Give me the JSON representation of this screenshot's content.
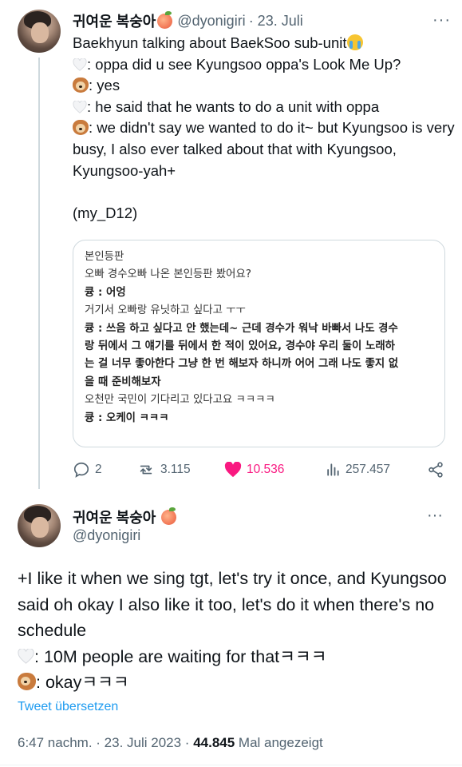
{
  "tweet1": {
    "display_name": "귀여운 복숭아",
    "handle": "@dyonigiri",
    "date": "· 23. Juli",
    "more": "···",
    "lines": [
      "Baekhyun talking about BaekSoo sub-unit",
      ": oppa did u see Kyungsoo oppa's Look Me Up?",
      ": yes",
      ": he said that he wants to do a unit with oppa",
      ": we didn't say we wanted to do it~ but Kyungsoo is very busy, I also ever talked about that with Kyungsoo, Kyungsoo-yah+",
      "(my_D12)"
    ],
    "image_text": [
      "본인등판",
      "오빠 경수오빠 나온 본인등판 봤어요?",
      "큥 : 어엉",
      "거기서 오빠랑 유닛하고 싶다고 ㅜㅜ",
      "큥 : 쓰음 하고 싶다고 안 했는데~ 근데 경수가 워낙 바빠서 나도 경수",
      "랑 뒤에서 그 얘기를 뒤에서 한 적이 있어요, 경수야 우리 둘이 노래하",
      "는 걸 너무 좋아한다 그냥 한 번 해보자 하니까 어어 그래 나도 좋지 없",
      "을 때 준비해보자",
      "오천만 국민이 기다리고 있다고요 ㅋㅋㅋㅋ",
      "큥 : 오케이 ㅋㅋㅋ"
    ],
    "actions": {
      "replies": "2",
      "retweets": "3.115",
      "likes": "10.536",
      "views": "257.457"
    }
  },
  "tweet2": {
    "display_name": "귀여운 복숭아",
    "handle": "@dyonigiri",
    "more": "···",
    "lines": [
      "+I like it when we sing tgt, let's try it once, and Kyungsoo said oh okay I also like it too, let's do it when there's no schedule",
      ": 10M people are waiting for thatㅋㅋㅋ",
      ": okayㅋㅋㅋ"
    ],
    "translate": "Tweet übersetzen",
    "time": "6:47 nachm. · 23. Juli 2023 · ",
    "views_count": "44.845",
    "views_label": " Mal angezeigt"
  },
  "colors": {
    "text": "#0f1419",
    "secondary": "#536471",
    "like": "#f91880",
    "link": "#1d9bf0",
    "divider": "#cfd9de"
  },
  "icons": [
    "avatar",
    "peach-emoji",
    "white-heart-emoji",
    "dog-emoji",
    "sob-emoji",
    "reply-icon",
    "retweet-icon",
    "like-icon",
    "views-icon",
    "share-icon",
    "more-icon"
  ]
}
